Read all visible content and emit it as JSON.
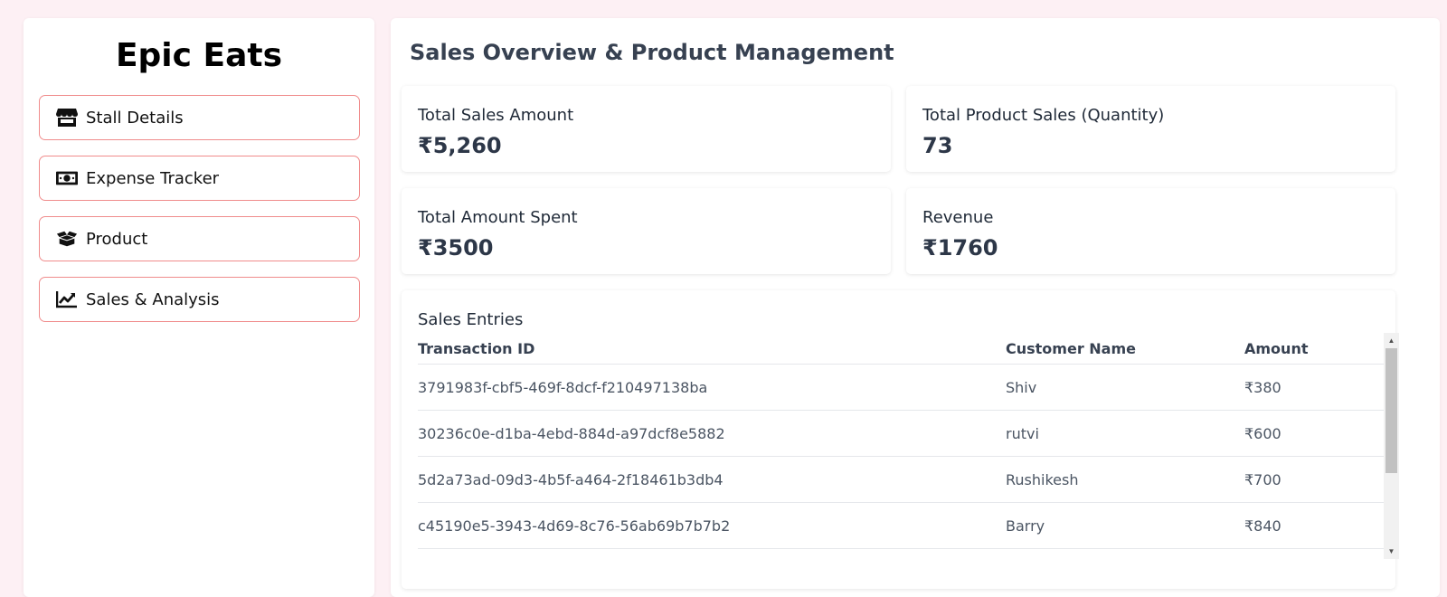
{
  "brand": "Epic Eats",
  "nav": {
    "items": [
      {
        "label": "Stall Details",
        "icon": "store-icon"
      },
      {
        "label": "Expense Tracker",
        "icon": "money-icon"
      },
      {
        "label": "Product",
        "icon": "box-icon"
      },
      {
        "label": "Sales & Analysis",
        "icon": "chart-line-icon"
      }
    ]
  },
  "main": {
    "title": "Sales Overview & Product Management",
    "stats": [
      {
        "label": "Total Sales Amount",
        "value": "₹5,260"
      },
      {
        "label": "Total Product Sales (Quantity)",
        "value": "73"
      },
      {
        "label": "Total Amount Spent",
        "value": "₹3500"
      },
      {
        "label": "Revenue",
        "value": "₹1760"
      }
    ],
    "sales": {
      "title": "Sales Entries",
      "columns": [
        "Transaction ID",
        "Customer Name",
        "Amount"
      ],
      "rows": [
        {
          "id": "3791983f-cbf5-469f-8dcf-f210497138ba",
          "customer": "Shiv",
          "amount": "₹380"
        },
        {
          "id": "30236c0e-d1ba-4ebd-884d-a97dcf8e5882",
          "customer": "rutvi",
          "amount": "₹600"
        },
        {
          "id": "5d2a73ad-09d3-4b5f-a464-2f18461b3db4",
          "customer": "Rushikesh",
          "amount": "₹700"
        },
        {
          "id": "c45190e5-3943-4d69-8c76-56ab69b7b7b2",
          "customer": "Barry",
          "amount": "₹840"
        }
      ]
    }
  },
  "colors": {
    "page_bg": "#fdf0f4",
    "nav_border": "#f08c8c",
    "heading": "#374151"
  }
}
